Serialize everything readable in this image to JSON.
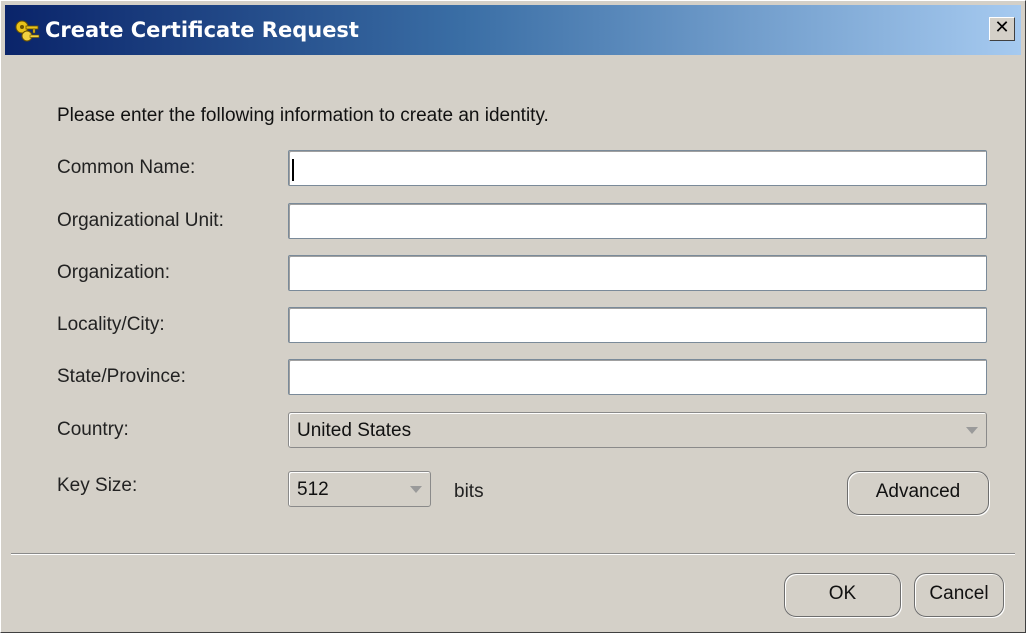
{
  "window": {
    "title": "Create Certificate Request",
    "close_label": "x"
  },
  "form": {
    "instruction": "Please enter the following information to create an identity.",
    "common_name": {
      "label": "Common Name:",
      "value": ""
    },
    "organizational_unit": {
      "label": "Organizational Unit:",
      "value": ""
    },
    "organization": {
      "label": "Organization:",
      "value": ""
    },
    "locality": {
      "label": "Locality/City:",
      "value": ""
    },
    "state": {
      "label": "State/Province:",
      "value": ""
    },
    "country": {
      "label": "Country:",
      "selected": "United States"
    },
    "key_size": {
      "label": "Key Size:",
      "selected": "512",
      "unit": "bits"
    },
    "advanced_label": "Advanced"
  },
  "footer": {
    "ok_label": "OK",
    "cancel_label": "Cancel"
  },
  "icons": {
    "title_icon": "keys-icon",
    "close_icon": "close-icon"
  }
}
